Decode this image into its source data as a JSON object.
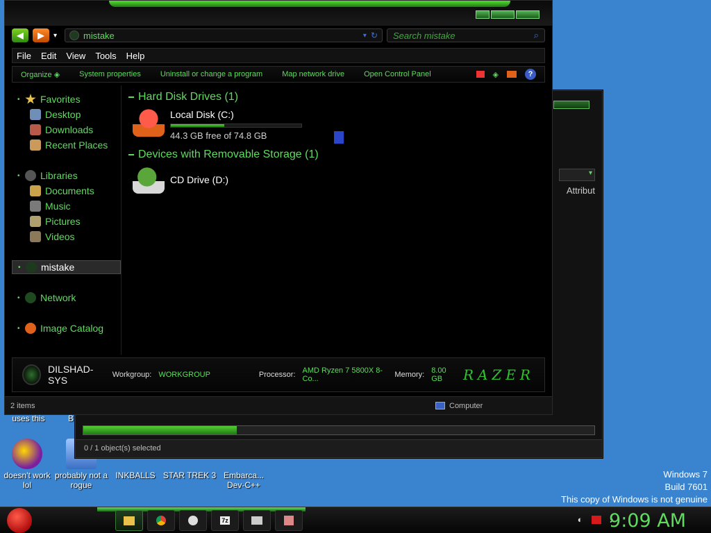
{
  "desktop": {
    "icons": [
      {
        "label": "doesn't work lol"
      },
      {
        "label": "probably not a rogue"
      },
      {
        "label": "INKBALLS"
      },
      {
        "label": "STAR TREK 3"
      },
      {
        "label": "Embarca... Dev-C++"
      }
    ],
    "partial_labels": [
      "uses this",
      "B"
    ],
    "watermark": {
      "line1": "Windows 7",
      "line2": "Build 7601",
      "line3": "This copy of Windows is not genuine"
    }
  },
  "back_window": {
    "column_header": "Attribut",
    "status_text": "0 / 1 object(s) selected",
    "progress_fraction": 0.3
  },
  "explorer": {
    "address": "mistake",
    "search_placeholder": "Search mistake",
    "menu": [
      "File",
      "Edit",
      "View",
      "Tools",
      "Help"
    ],
    "commands": [
      "Organize",
      "System properties",
      "Uninstall or change a program",
      "Map network drive",
      "Open Control Panel"
    ],
    "help_glyph": "?",
    "nav": {
      "favorites": "Favorites",
      "desktop": "Desktop",
      "downloads": "Downloads",
      "recent": "Recent Places",
      "libraries": "Libraries",
      "documents": "Documents",
      "music": "Music",
      "pictures": "Pictures",
      "videos": "Videos",
      "computer": "mistake",
      "network": "Network",
      "image_catalog": "Image Catalog"
    },
    "groups": {
      "hdd": "Hard Disk Drives (1)",
      "removable": "Devices with Removable Storage (1)"
    },
    "drives": {
      "c_name": "Local Disk (C:)",
      "c_free": "44.3 GB free of 74.8 GB",
      "c_used_fraction": 0.41,
      "d_name": "CD Drive (D:)"
    },
    "details": {
      "pc_name": "DILSHAD-SYS",
      "workgroup_label": "Workgroup:",
      "workgroup_value": "WORKGROUP",
      "processor_label": "Processor:",
      "processor_value": "AMD Ryzen 7 5800X 8-Co...",
      "memory_label": "Memory:",
      "memory_value": "8.00 GB",
      "brand": "RAZER"
    },
    "status": {
      "items": "2 items",
      "location": "Computer"
    }
  },
  "taskbar": {
    "clock": "9:09 AM",
    "buttons": [
      "",
      "",
      "",
      "7z",
      "",
      ""
    ]
  },
  "colors": {
    "accent_green": "#5fdc5f",
    "desktop_blue": "#3a83cf",
    "window_bg": "#000000"
  }
}
